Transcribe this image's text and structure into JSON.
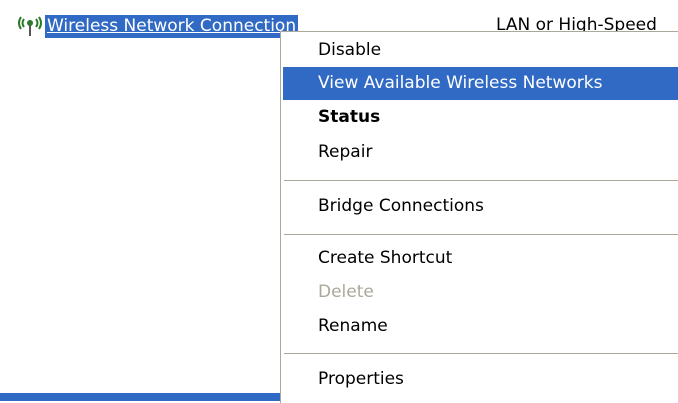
{
  "connection": {
    "name": "Wireless Network Connection",
    "type_text": "LAN or High-Speed",
    "icon": "wireless-antenna-icon"
  },
  "menu": {
    "items": [
      {
        "label": "Disable",
        "state": "normal"
      },
      {
        "label": "View Available Wireless Networks",
        "state": "highlighted"
      },
      {
        "label": "Status",
        "state": "bold"
      },
      {
        "label": "Repair",
        "state": "normal"
      },
      {
        "label": "Bridge Connections",
        "state": "normal"
      },
      {
        "label": "Create Shortcut",
        "state": "normal"
      },
      {
        "label": "Delete",
        "state": "disabled"
      },
      {
        "label": "Rename",
        "state": "normal"
      },
      {
        "label": "Properties",
        "state": "normal"
      }
    ]
  },
  "colors": {
    "selection": "#316ac5",
    "disabled_text": "#aca899",
    "separator": "#aca899"
  }
}
